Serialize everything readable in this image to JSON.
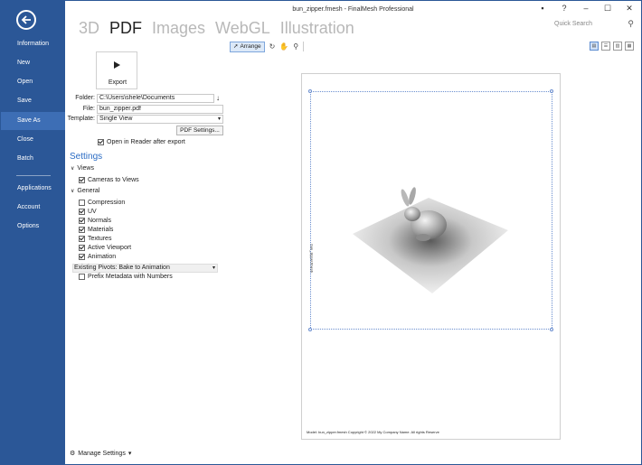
{
  "window": {
    "title": "bun_zipper.fmesh - FinalMesh Professional",
    "controls": [
      "▪",
      "?",
      "–",
      "☐",
      "✕"
    ]
  },
  "quick_search": {
    "placeholder": "Quick Search"
  },
  "nav": {
    "items": [
      {
        "label": "Information"
      },
      {
        "label": "New"
      },
      {
        "label": "Open"
      },
      {
        "label": "Save"
      },
      {
        "label": "Save As",
        "active": true
      },
      {
        "label": "Close"
      },
      {
        "label": "Batch"
      },
      {
        "label": "Applications"
      },
      {
        "label": "Account"
      },
      {
        "label": "Options"
      }
    ]
  },
  "modes": {
    "tabs": [
      {
        "label": "3D"
      },
      {
        "label": "PDF",
        "active": true
      },
      {
        "label": "Images"
      },
      {
        "label": "WebGL"
      },
      {
        "label": "Illustration"
      }
    ]
  },
  "toolbar": {
    "arrange_label": "Arrange"
  },
  "export": {
    "button_label": "Export",
    "folder_label": "Folder:",
    "folder_value": "C:\\Users\\shele\\Documents",
    "file_label": "File:",
    "file_value": "bun_zipper.pdf",
    "template_label": "Template:",
    "template_value": "Single View",
    "pdf_settings_label": "PDF Settings...",
    "open_reader_label": "Open in Reader after export"
  },
  "settings": {
    "title": "Settings",
    "views_group": "Views",
    "cameras_to_views": "Cameras to Views",
    "general_group": "General",
    "options": [
      {
        "label": "Compression",
        "checked": false
      },
      {
        "label": "UV",
        "checked": true
      },
      {
        "label": "Normals",
        "checked": true
      },
      {
        "label": "Materials",
        "checked": true
      },
      {
        "label": "Textures",
        "checked": true
      },
      {
        "label": "Active Viewport",
        "checked": true
      },
      {
        "label": "Animation",
        "checked": true
      }
    ],
    "existing_pivots": "Existing Pivots: Bake to Animation",
    "prefix_metadata": "Prefix Metadata with Numbers"
  },
  "manage_settings": "Manage Settings",
  "preview": {
    "side_label": "bun_zipper.fmesh",
    "footer_note": "Model: bun_zipper.fmesh Copyright © 2022 My Company Name. All rights Reserve"
  },
  "colors": {
    "nav_bg": "#2b5797",
    "accent": "#2b6cc4"
  }
}
